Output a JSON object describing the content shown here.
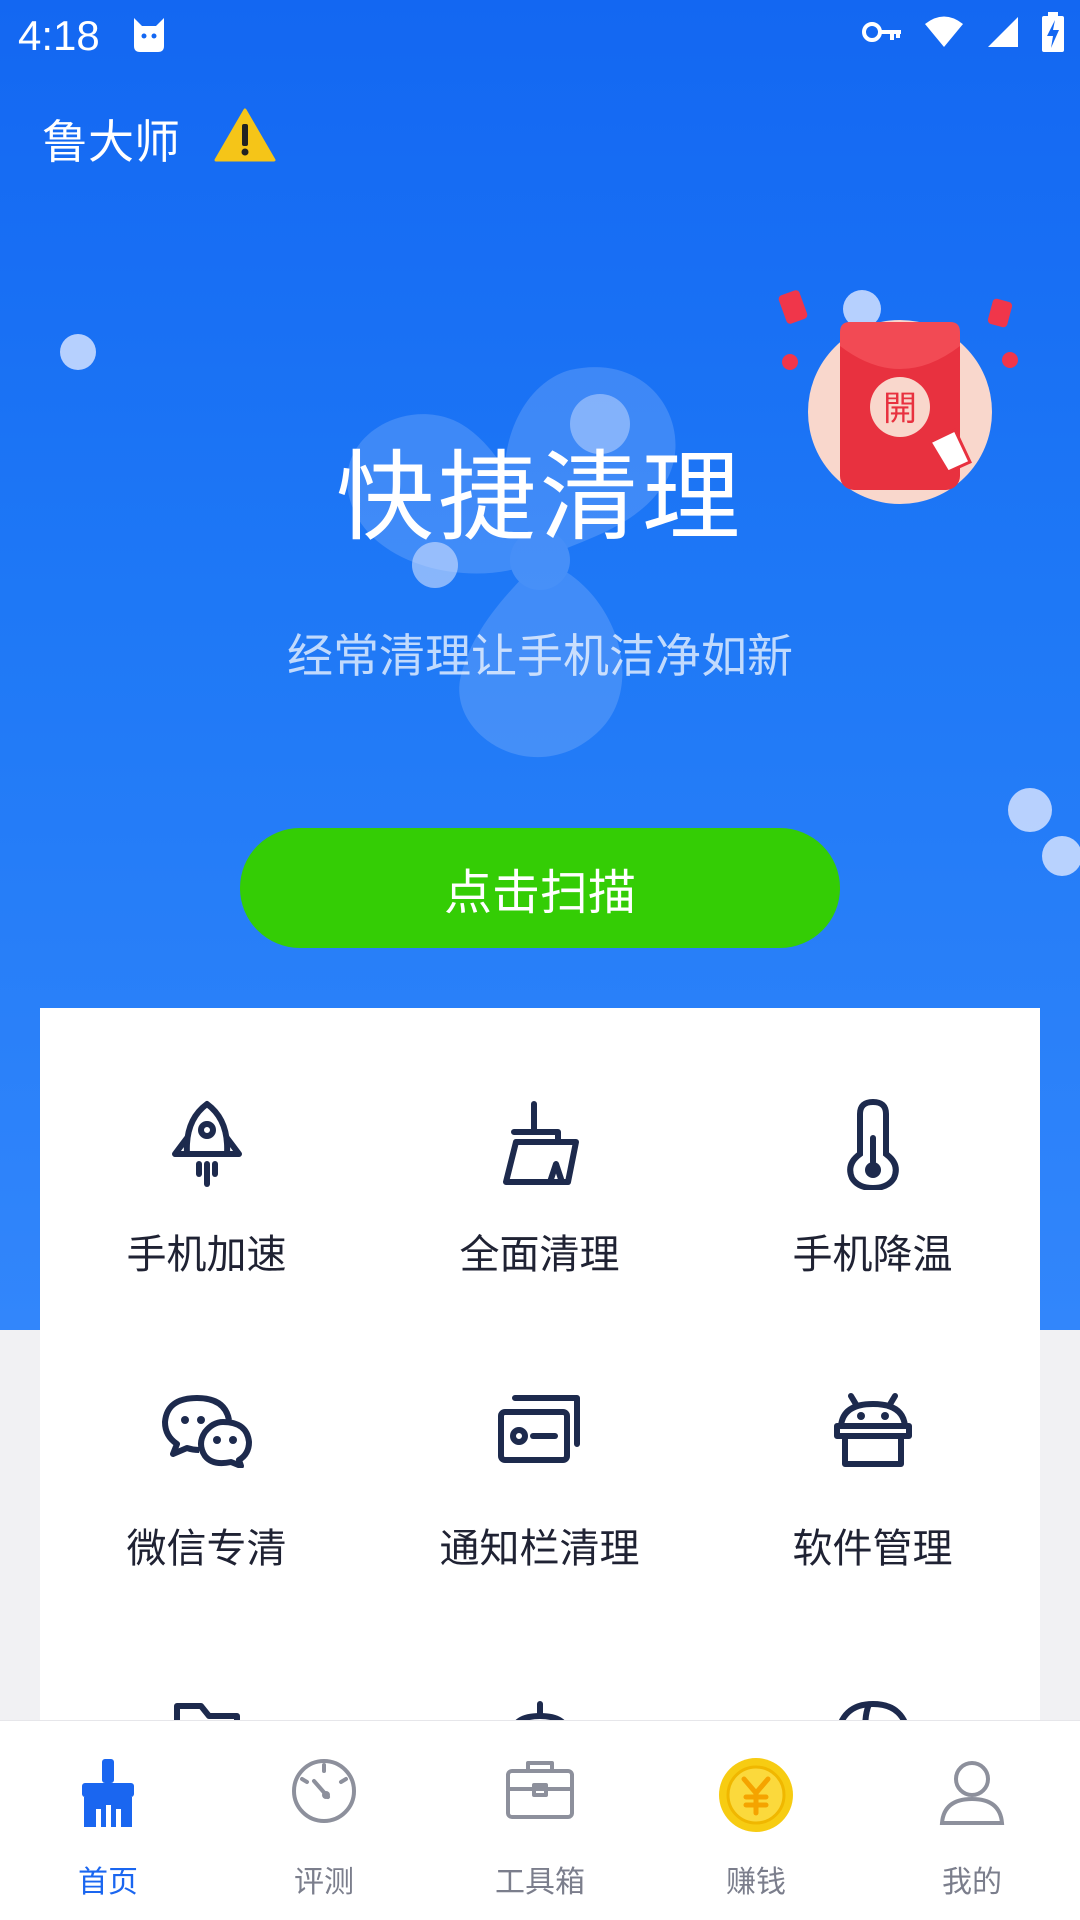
{
  "status_bar": {
    "time": "4:18"
  },
  "header": {
    "app_title": "鲁大师"
  },
  "hero": {
    "title": "快捷清理",
    "subtitle": "经常清理让手机洁净如新",
    "scan_button": "点击扫描",
    "red_packet_char": "開"
  },
  "tools": [
    {
      "label": "手机加速",
      "icon": "rocket-icon"
    },
    {
      "label": "全面清理",
      "icon": "broom-icon"
    },
    {
      "label": "手机降温",
      "icon": "thermometer-icon"
    },
    {
      "label": "微信专清",
      "icon": "wechat-icon"
    },
    {
      "label": "通知栏清理",
      "icon": "notification-icon"
    },
    {
      "label": "软件管理",
      "icon": "android-icon"
    }
  ],
  "nav": [
    {
      "label": "首页",
      "icon": "home-broom-icon",
      "active": true
    },
    {
      "label": "评测",
      "icon": "speedometer-icon",
      "active": false
    },
    {
      "label": "工具箱",
      "icon": "toolbox-icon",
      "active": false
    },
    {
      "label": "赚钱",
      "icon": "coin-icon",
      "active": false
    },
    {
      "label": "我的",
      "icon": "profile-icon",
      "active": false
    }
  ],
  "colors": {
    "hero_blue": "#1367f2",
    "scan_green": "#34cd05",
    "nav_active": "#1a66f0",
    "icon_dark": "#1d2a4d"
  }
}
